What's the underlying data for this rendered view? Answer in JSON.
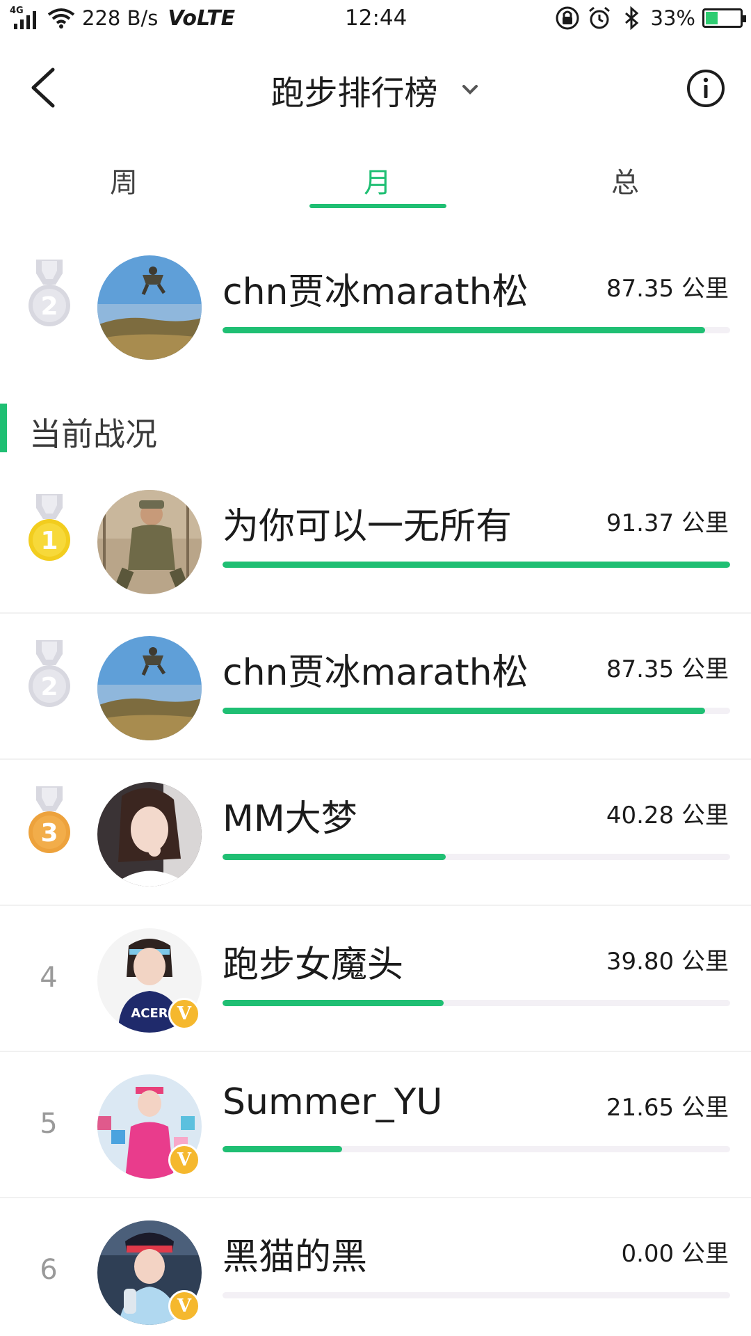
{
  "status_bar": {
    "network_tag": "4G",
    "speed": "228 B/s",
    "volte": "VoLTE",
    "time": "12:44",
    "battery_percent": "33%",
    "battery_level": 0.33,
    "icons": [
      "signal-icon",
      "wifi-icon",
      "lock-rotation-icon",
      "alarm-icon",
      "bluetooth-icon",
      "battery-icon"
    ]
  },
  "header": {
    "title": "跑步排行榜",
    "back_icon": "back-chevron-icon",
    "dropdown_icon": "chevron-down-icon",
    "info_icon": "info-icon"
  },
  "tabs": [
    {
      "label": "周",
      "active": false
    },
    {
      "label": "月",
      "active": true
    },
    {
      "label": "总",
      "active": false
    }
  ],
  "my_rank": {
    "rank": 2,
    "name": "chn贾冰marath松",
    "distance": "87.35 公里",
    "progress": 0.95
  },
  "section": {
    "title": "当前战况"
  },
  "leaderboard": [
    {
      "rank": "1",
      "medal": "gold",
      "name": "为你可以一无所有",
      "distance": "91.37 公里",
      "progress": 1.0,
      "verified": false
    },
    {
      "rank": "2",
      "medal": "silver",
      "name": "chn贾冰marath松",
      "distance": "87.35 公里",
      "progress": 0.95,
      "verified": false
    },
    {
      "rank": "3",
      "medal": "bronze",
      "name": "MM大梦",
      "distance": "40.28 公里",
      "progress": 0.44,
      "verified": false
    },
    {
      "rank": "4",
      "medal": null,
      "name": "跑步女魔头",
      "distance": "39.80 公里",
      "progress": 0.435,
      "verified": true,
      "badge": "V"
    },
    {
      "rank": "5",
      "medal": null,
      "name": "Summer_YU",
      "distance": "21.65 公里",
      "progress": 0.235,
      "verified": true,
      "badge": "V"
    },
    {
      "rank": "6",
      "medal": null,
      "name": "黑猫的黑",
      "distance": "0.00 公里",
      "progress": 0.0,
      "verified": true,
      "badge": "V"
    }
  ],
  "colors": {
    "accent": "#1fbf73",
    "track": "#f3f0f5",
    "gold": "#f2cd1e",
    "silver": "#d8d8e0",
    "bronze": "#eda23c",
    "badge": "#f5b82e"
  }
}
